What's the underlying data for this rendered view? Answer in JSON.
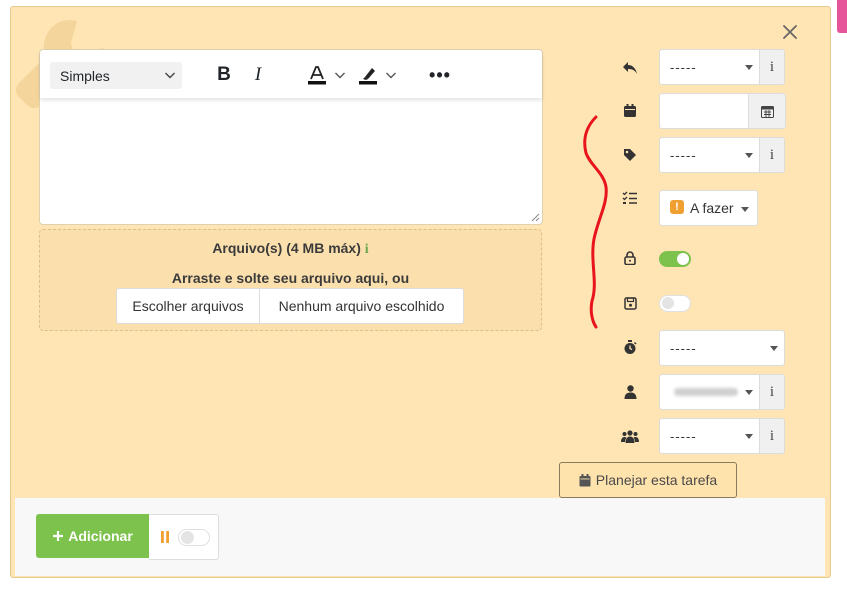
{
  "editor": {
    "style_select": "Simples",
    "bold_label": "B",
    "italic_label": "I",
    "font_color_label": "A",
    "more_label": "•••"
  },
  "upload": {
    "title": "Arquivo(s) (4 MB máx)",
    "info": "i",
    "drop_text": "Arraste e solte seu arquivo aqui, ou",
    "choose_label": "Escolher arquivos",
    "no_file_label": "Nenhum arquivo escolhido"
  },
  "fields": {
    "reply_value": "-----",
    "tag_value": "-----",
    "status_badge": "!",
    "status_value": "A fazer",
    "timer_value": "-----",
    "group_value": "-----",
    "info_label": "i"
  },
  "toggles": {
    "lock_on": true,
    "save_on": false,
    "pause_on": false
  },
  "plan_button": "Planejar esta tarefa",
  "add_button": "Adicionar",
  "colors": {
    "accent_green": "#7cc24d",
    "modal_bg": "#ffe5b4",
    "status_orange": "#f0a030",
    "annotation_red": "#e8141c"
  }
}
